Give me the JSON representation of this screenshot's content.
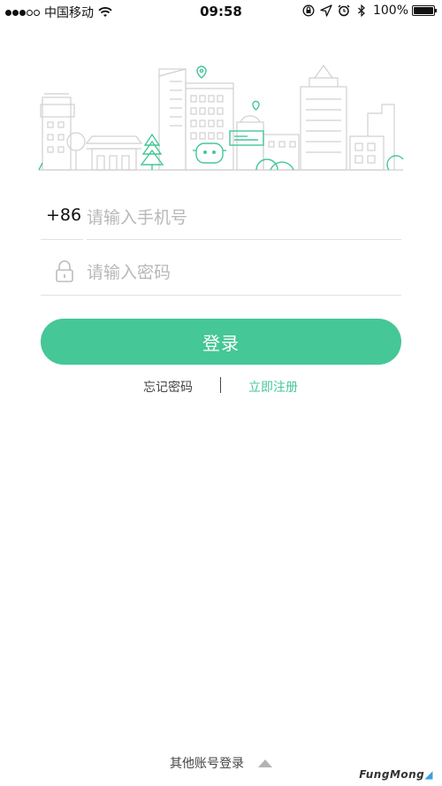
{
  "status_bar": {
    "carrier": "中国移动",
    "time": "09:58",
    "battery": "100%",
    "battery_level": 1.0,
    "signal_bars_filled": 3,
    "signal_bars_total": 5
  },
  "form": {
    "country_code": "+86",
    "phone_placeholder": "请输入手机号",
    "password_placeholder": "请输入密码"
  },
  "login_button": "登录",
  "links": {
    "forgot_password": "忘记密码",
    "register": "立即注册"
  },
  "footer": {
    "other_accounts": "其他账号登录"
  },
  "watermark": "FungMong",
  "colors": {
    "accent": "#45c797",
    "placeholder": "#b8b8b8",
    "divider": "#e2e2e2"
  }
}
